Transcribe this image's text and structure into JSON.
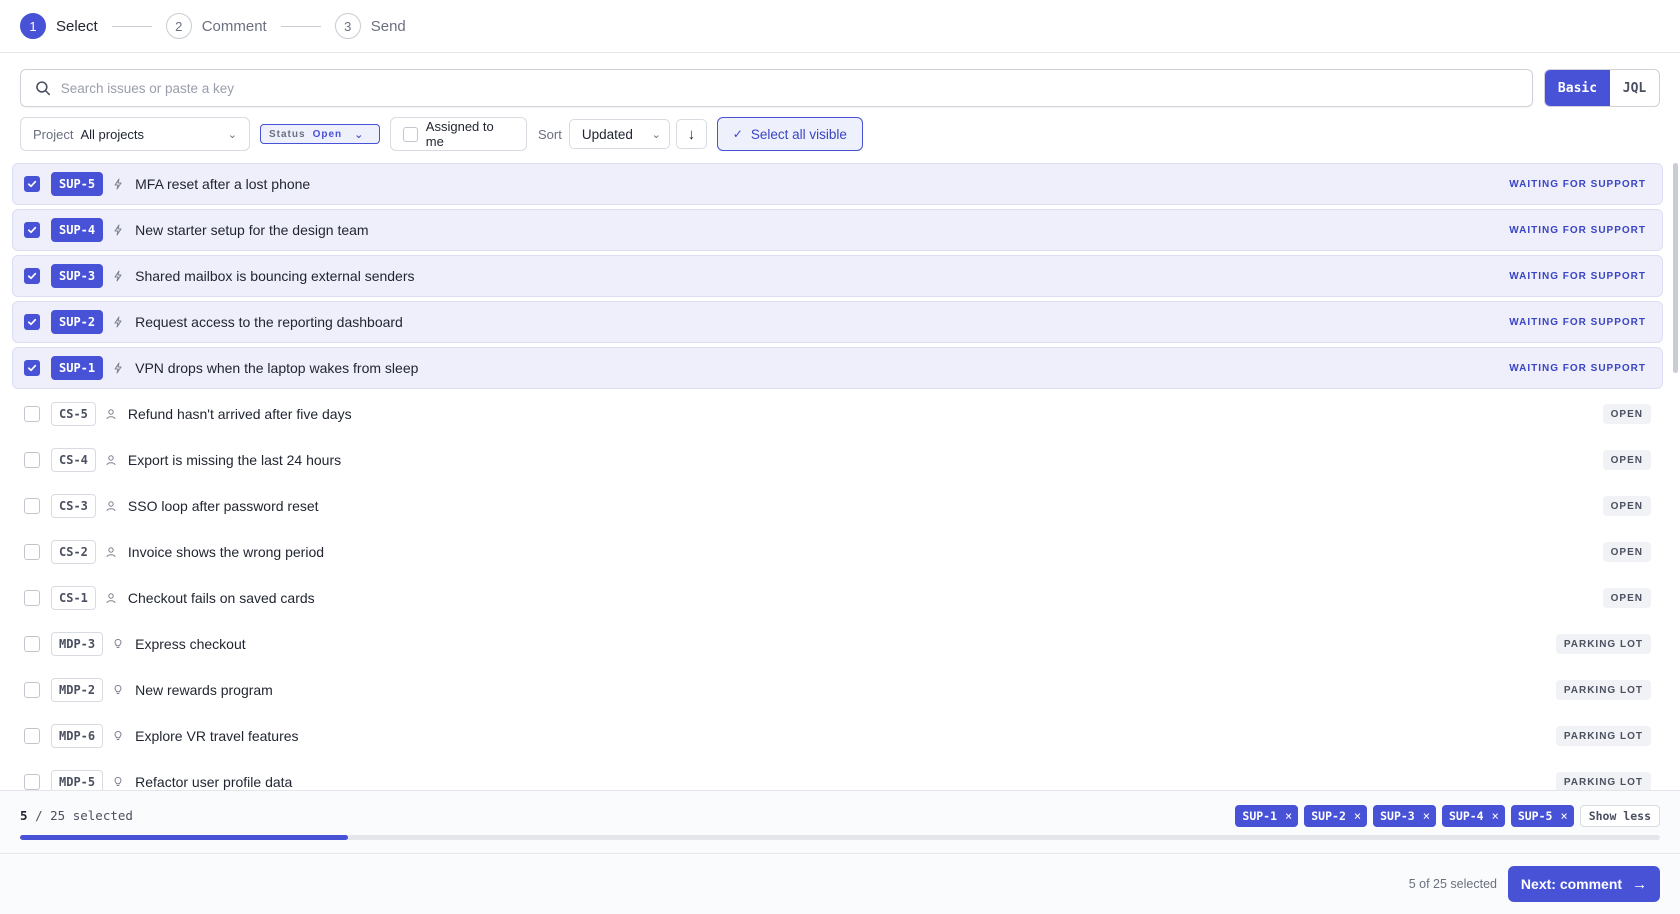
{
  "stepper": [
    {
      "num": "1",
      "label": "Select",
      "active": true
    },
    {
      "num": "2",
      "label": "Comment",
      "active": false
    },
    {
      "num": "3",
      "label": "Send",
      "active": false
    }
  ],
  "search": {
    "placeholder": "Search issues or paste a key",
    "value": ""
  },
  "mode": {
    "basic": "Basic",
    "jql": "JQL",
    "active": "Basic"
  },
  "filters": {
    "project_label": "Project",
    "project_value": "All projects",
    "status_label": "Status",
    "status_value": "Open",
    "assigned_label": "Assigned to me",
    "assigned_checked": false,
    "sort_label": "Sort",
    "sort_value": "Updated",
    "sort_direction_icon": "↓",
    "select_all_label": "Select all visible"
  },
  "issues": [
    {
      "key": "SUP-5",
      "type_icon": "bolt-icon",
      "title": "MFA reset after a lost phone",
      "status": "WAITING FOR SUPPORT",
      "selected": true
    },
    {
      "key": "SUP-4",
      "type_icon": "bolt-icon",
      "title": "New starter setup for the design team",
      "status": "WAITING FOR SUPPORT",
      "selected": true
    },
    {
      "key": "SUP-3",
      "type_icon": "bolt-icon",
      "title": "Shared mailbox is bouncing external senders",
      "status": "WAITING FOR SUPPORT",
      "selected": true
    },
    {
      "key": "SUP-2",
      "type_icon": "bolt-icon",
      "title": "Request access to the reporting dashboard",
      "status": "WAITING FOR SUPPORT",
      "selected": true
    },
    {
      "key": "SUP-1",
      "type_icon": "bolt-icon",
      "title": "VPN drops when the laptop wakes from sleep",
      "status": "WAITING FOR SUPPORT",
      "selected": true
    },
    {
      "key": "CS-5",
      "type_icon": "person-icon",
      "title": "Refund hasn't arrived after five days",
      "status": "OPEN",
      "selected": false
    },
    {
      "key": "CS-4",
      "type_icon": "person-icon",
      "title": "Export is missing the last 24 hours",
      "status": "OPEN",
      "selected": false
    },
    {
      "key": "CS-3",
      "type_icon": "person-icon",
      "title": "SSO loop after password reset",
      "status": "OPEN",
      "selected": false
    },
    {
      "key": "CS-2",
      "type_icon": "person-icon",
      "title": "Invoice shows the wrong period",
      "status": "OPEN",
      "selected": false
    },
    {
      "key": "CS-1",
      "type_icon": "person-icon",
      "title": "Checkout fails on saved cards",
      "status": "OPEN",
      "selected": false
    },
    {
      "key": "MDP-3",
      "type_icon": "lightbulb-icon",
      "title": "Express checkout",
      "status": "PARKING LOT",
      "selected": false
    },
    {
      "key": "MDP-2",
      "type_icon": "lightbulb-icon",
      "title": "New rewards program",
      "status": "PARKING LOT",
      "selected": false
    },
    {
      "key": "MDP-6",
      "type_icon": "lightbulb-icon",
      "title": "Explore VR travel features",
      "status": "PARKING LOT",
      "selected": false
    },
    {
      "key": "MDP-5",
      "type_icon": "lightbulb-icon",
      "title": "Refactor user profile data",
      "status": "PARKING LOT",
      "selected": false
    }
  ],
  "selection": {
    "count": "5",
    "separator": "/",
    "total": "25",
    "suffix": "selected",
    "progress_fraction": 0.2,
    "chips": [
      "SUP-1",
      "SUP-2",
      "SUP-3",
      "SUP-4",
      "SUP-5"
    ],
    "show_less_label": "Show less"
  },
  "footer": {
    "count_text": "5 of 25 selected",
    "next_label": "Next: comment"
  },
  "colors": {
    "accent": "#4752d6",
    "selected_row_bg": "#eeeffb"
  }
}
